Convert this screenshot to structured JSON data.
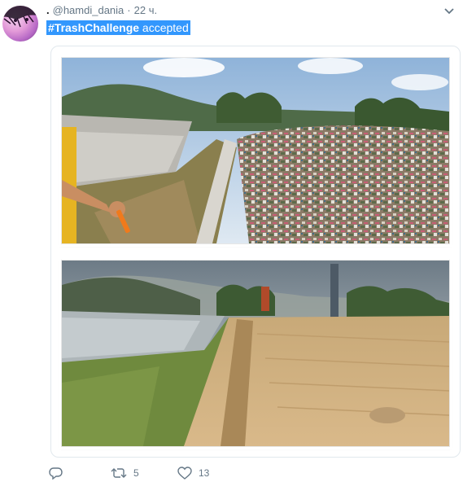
{
  "tweet": {
    "user_name": ".",
    "handle": "@hamdi_dania",
    "separator": "·",
    "time": "22 ч.",
    "hashtag": "#TrashChallenge",
    "text": " accepted"
  },
  "icons": {
    "more": "chevron-down-icon",
    "reply": "reply-icon",
    "retweet": "retweet-icon",
    "like": "heart-icon"
  },
  "actions": {
    "reply_count": "",
    "retweet_count": "5",
    "like_count": "13"
  },
  "colors": {
    "selection": "#3297fd",
    "secondary_text": "#657786",
    "border": "#e1e8ed"
  }
}
